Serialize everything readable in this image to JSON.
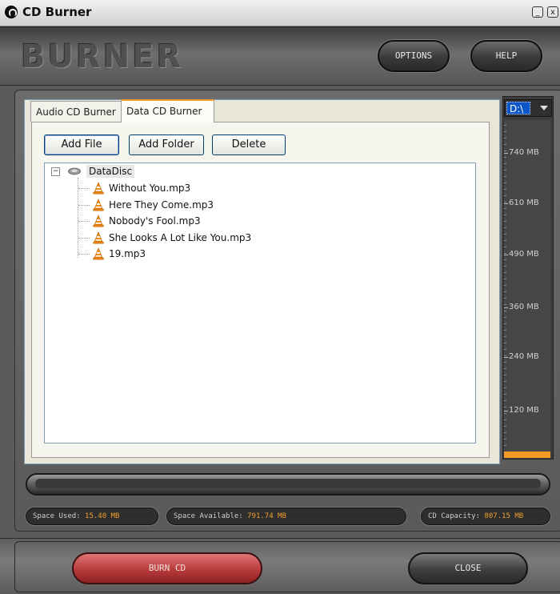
{
  "window": {
    "title": "CD Burner"
  },
  "header": {
    "logo_text": "BURNER",
    "options_label": "OPTIONS",
    "help_label": "HELP"
  },
  "tabs": [
    {
      "label": "Audio CD Burner",
      "active": false
    },
    {
      "label": "Data CD Burner",
      "active": true
    }
  ],
  "toolbar": {
    "add_file_label": "Add File",
    "add_folder_label": "Add Folder",
    "delete_label": "Delete"
  },
  "tree": {
    "root_label": "DataDisc",
    "root_icon": "disc-drive-icon",
    "file_icon": "vlc-cone-icon",
    "files": [
      "Without You.mp3",
      "Here They Come.mp3",
      "Nobody's Fool.mp3",
      "She Looks A Lot Like You.mp3",
      "19.mp3"
    ]
  },
  "meter": {
    "drive": "D:\\",
    "labels": [
      "740 MB",
      "610 MB",
      "490 MB",
      "360 MB",
      "240 MB",
      "120 MB"
    ],
    "max_mb": 807.15,
    "used_mb": 15.4,
    "fill_color": "#f39a2a"
  },
  "status": {
    "space_used_label": "Space Used:",
    "space_used_value": "15.40 MB",
    "space_available_label": "Space Available:",
    "space_available_value": "791.74 MB",
    "cd_capacity_label": "CD Capacity:",
    "cd_capacity_value": "807.15 MB"
  },
  "footer": {
    "burn_label": "BURN CD",
    "close_label": "CLOSE"
  },
  "colors": {
    "accent": "#f0a030",
    "burn_button": "#b83a3a",
    "selected_drive": "#0a56c8"
  }
}
